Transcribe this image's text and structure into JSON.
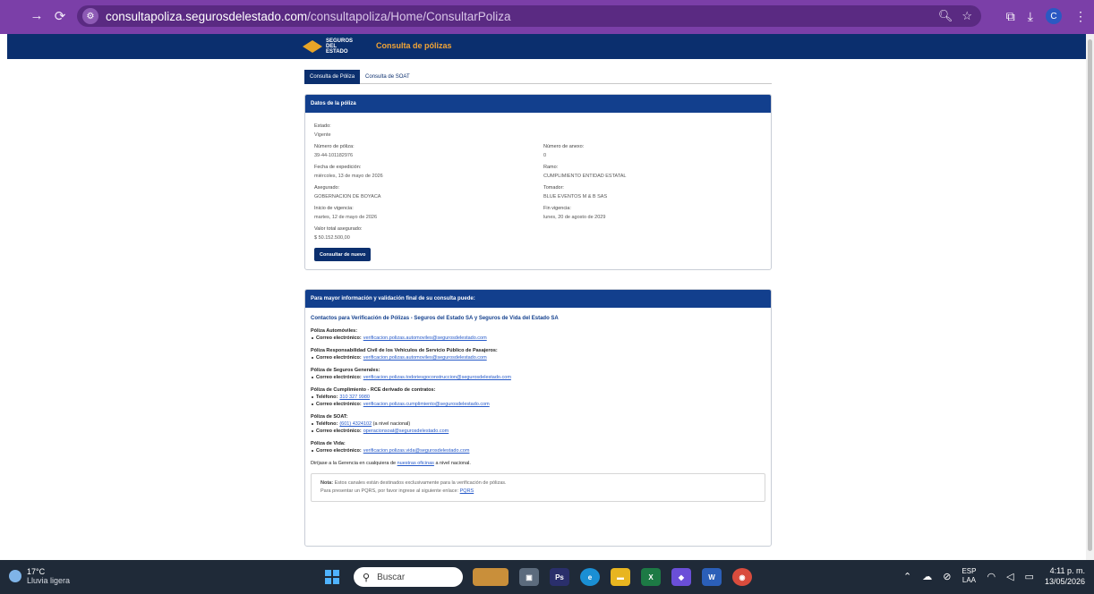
{
  "browser": {
    "url_host": "consultapoliza.segurosdelestado.com",
    "url_path": "/consultapoliza/Home/ConsultarPoliza",
    "avatar_letter": "C"
  },
  "header": {
    "logo_line1": "SEGUROS",
    "logo_line2": "DEL",
    "logo_line3": "ESTADO",
    "title": "Consulta de pólizas"
  },
  "tabs": [
    {
      "label": "Consulta de Póliza",
      "active": true
    },
    {
      "label": "Consulta de SOAT",
      "active": false
    }
  ],
  "policy": {
    "header": "Datos de la póliza",
    "estado_label": "Estado:",
    "estado_value": "Vigente",
    "numero_label": "Número de póliza:",
    "numero_value": "39-44-101182976",
    "anexo_label": "Número de anexo:",
    "anexo_value": "0",
    "expedicion_label": "Fecha de expedición:",
    "expedicion_value": "miércoles, 13 de mayo de 2026",
    "ramo_label": "Ramo:",
    "ramo_value": "CUMPLIMIENTO ENTIDAD ESTATAL",
    "asegurado_label": "Asegurado:",
    "asegurado_value": "GOBERNACION DE BOYACA",
    "tomador_label": "Tomador:",
    "tomador_value": "BLUE EVENTOS M & B SAS",
    "inicio_label": "Inicio de vigencia:",
    "inicio_value": "martes, 12 de mayo de 2026",
    "fin_label": "Fin vigencia:",
    "fin_value": "lunes, 20 de agosto de 2029",
    "valor_label": "Valor total asegurado:",
    "valor_value": "$ 50.152.500,00",
    "button": "Consultar de nuevo"
  },
  "info": {
    "header": "Para mayor información y validación final de su consulta puede:",
    "headline": "Contactos para Verificación de Pólizas - Seguros del Estado SA y Seguros de Vida del Estado SA",
    "email_key": "Correo electrónico:",
    "phone_key": "Teléfono:",
    "s1_title": "Póliza Automóviles:",
    "s1_email": "verificacion.polizas.automoviles@segurosdelestado.com",
    "s2_title": "Póliza Responsabilidad Civil de los Vehículos de Servicio Público de Pasajeros:",
    "s2_email": "verificacion.polizas.automoviles@segurosdelestado.com",
    "s3_title": "Póliza de Seguros Generales:",
    "s3_email": "verificacion.polizas.todoriesgoconstruccion@segurosdelestado.com",
    "s4_title": "Póliza de Cumplimiento - RCE derivado de contratos:",
    "s4_phone": "310 327 9980",
    "s4_email": "verificacion.polizas.cumplimiento@segurosdelestado.com",
    "s5_title": "Póliza de SOAT:",
    "s5_phone": "(601) 4324102",
    "s5_phone_note": "(a nivel nacional)",
    "s5_email": "operacionsoat@segurosdelestado.com",
    "s6_title": "Póliza de Vida:",
    "s6_email": "verificacion.polizas.vida@segurosdelestado.com",
    "direct_pre": "Diríjase a la Gerencia en cualquiera de",
    "direct_link": "nuestras oficinas",
    "direct_post": "a nivel nacional.",
    "note_bold": "Nota:",
    "note_text": "Estos canales están destinados exclusivamente para la verificación de pólizas.",
    "note_line2": "Para presentar un PQRS, por favor ingrese al siguiente enlace:",
    "note_link": "PQRS"
  },
  "taskbar": {
    "temp": "17°C",
    "weather": "Lluvia ligera",
    "search": "Buscar",
    "lang1": "ESP",
    "lang2": "LAA",
    "time": "4:11 p. m.",
    "date": "13/05/2026"
  }
}
